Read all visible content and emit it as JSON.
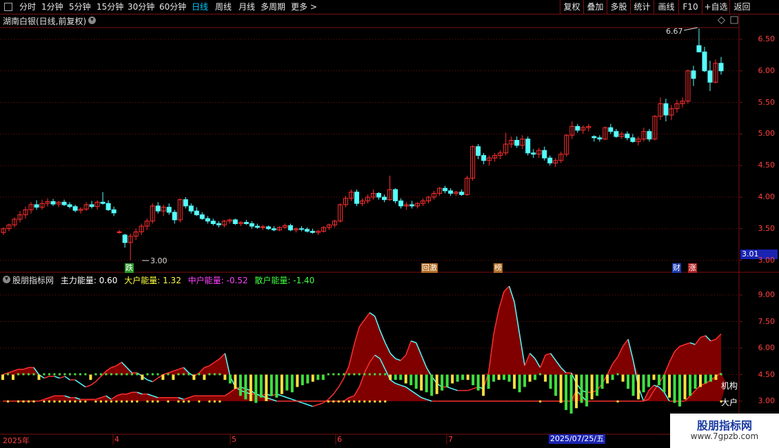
{
  "toolbar": {
    "periods": [
      {
        "label": "分时",
        "active": false
      },
      {
        "label": "1分钟",
        "active": false
      },
      {
        "label": "5分钟",
        "active": false
      },
      {
        "label": "15分钟",
        "active": false
      },
      {
        "label": "30分钟",
        "active": false
      },
      {
        "label": "60分钟",
        "active": false
      },
      {
        "label": "日线",
        "active": true
      },
      {
        "label": "周线",
        "active": false
      },
      {
        "label": "月线",
        "active": false
      },
      {
        "label": "多周期",
        "active": false
      },
      {
        "label": "更多 >",
        "active": false
      }
    ],
    "actions": [
      "复权",
      "叠加",
      "多股",
      "统计",
      "画线",
      "F10",
      "+自选",
      "返回"
    ]
  },
  "stock": {
    "title": "湖南白银(日线,前复权)",
    "dropdown_icon": "chevron-down-icon",
    "high_annotation": "6.67",
    "low_annotation": "3.00",
    "price_badge": "3.01",
    "tools_icons": [
      "diamond-icon",
      "chart-toggle-icon"
    ]
  },
  "price_axis": [
    "6.50",
    "6.00",
    "5.50",
    "5.00",
    "4.50",
    "4.00",
    "3.50",
    "3.00"
  ],
  "events": [
    {
      "label": "跌",
      "color": "#2a9a2a",
      "text_color": "#fff"
    },
    {
      "label": "回激",
      "color": "#b06a20",
      "text_color": "#fff"
    },
    {
      "label": "榜",
      "color": "#b06a20",
      "text_color": "#fff"
    },
    {
      "label": "财",
      "color": "#1a3ab0",
      "text_color": "#fff"
    },
    {
      "label": "涨",
      "color": "#b02020",
      "text_color": "#fff"
    }
  ],
  "indicator": {
    "name": "股朋指标网",
    "legend": [
      {
        "label": "主力能量: 0.60",
        "color": "#ffffff"
      },
      {
        "label": "大户能量: 1.32",
        "color": "#ffff40"
      },
      {
        "label": "中户能量: -0.52",
        "color": "#ff40ff"
      },
      {
        "label": "散户能量: -1.40",
        "color": "#40ff40"
      }
    ],
    "axis": [
      "9.00",
      "7.50",
      "6.00",
      "4.50",
      "3.00"
    ],
    "line_labels": [
      "机构",
      "大户"
    ]
  },
  "dates": {
    "labels": [
      "2025年",
      "4",
      "5",
      "6",
      "7"
    ],
    "cursor": "2025/07/25/五"
  },
  "watermark": {
    "title": "股朋指标网",
    "url": "www.7gpzb.com"
  },
  "colors": {
    "up": "#ff3030",
    "down": "#54ffff",
    "grid": "#7a1010",
    "area": "#800000"
  },
  "chart_data": {
    "type": "candlestick",
    "y_range": [
      3.0,
      6.75
    ],
    "candles": [
      [
        3.44,
        3.52,
        3.4,
        3.5
      ],
      [
        3.5,
        3.58,
        3.46,
        3.56
      ],
      [
        3.56,
        3.68,
        3.52,
        3.65
      ],
      [
        3.65,
        3.78,
        3.6,
        3.72
      ],
      [
        3.72,
        3.85,
        3.66,
        3.8
      ],
      [
        3.8,
        3.92,
        3.74,
        3.88
      ],
      [
        3.88,
        3.95,
        3.8,
        3.84
      ],
      [
        3.84,
        3.96,
        3.8,
        3.9
      ],
      [
        3.9,
        3.98,
        3.85,
        3.93
      ],
      [
        3.93,
        3.97,
        3.86,
        3.89
      ],
      [
        3.89,
        3.94,
        3.84,
        3.92
      ],
      [
        3.92,
        3.96,
        3.86,
        3.88
      ],
      [
        3.88,
        3.92,
        3.82,
        3.85
      ],
      [
        3.85,
        3.88,
        3.76,
        3.79
      ],
      [
        3.79,
        3.84,
        3.74,
        3.81
      ],
      [
        3.81,
        3.92,
        3.78,
        3.88
      ],
      [
        3.88,
        3.94,
        3.82,
        3.85
      ],
      [
        3.85,
        3.95,
        3.8,
        3.92
      ],
      [
        3.92,
        4.08,
        3.88,
        3.9
      ],
      [
        3.9,
        3.95,
        3.78,
        3.8
      ],
      [
        3.8,
        3.85,
        3.7,
        3.75
      ],
      [
        3.45,
        3.48,
        3.42,
        3.45
      ],
      [
        3.4,
        3.42,
        3.2,
        3.28
      ],
      [
        3.28,
        3.42,
        3.0,
        3.38
      ],
      [
        3.38,
        3.5,
        3.32,
        3.45
      ],
      [
        3.45,
        3.58,
        3.4,
        3.54
      ],
      [
        3.54,
        3.66,
        3.48,
        3.62
      ],
      [
        3.62,
        3.9,
        3.58,
        3.86
      ],
      [
        3.86,
        3.92,
        3.74,
        3.78
      ],
      [
        3.78,
        3.88,
        3.7,
        3.84
      ],
      [
        3.84,
        3.9,
        3.72,
        3.76
      ],
      [
        3.76,
        3.8,
        3.58,
        3.64
      ],
      [
        3.64,
        3.98,
        3.6,
        3.96
      ],
      [
        3.96,
        4.0,
        3.82,
        3.86
      ],
      [
        3.86,
        3.9,
        3.74,
        3.78
      ],
      [
        3.78,
        3.84,
        3.7,
        3.72
      ],
      [
        3.72,
        3.76,
        3.64,
        3.66
      ],
      [
        3.66,
        3.7,
        3.58,
        3.62
      ],
      [
        3.62,
        3.66,
        3.55,
        3.58
      ],
      [
        3.58,
        3.62,
        3.52,
        3.56
      ],
      [
        3.56,
        3.64,
        3.52,
        3.62
      ],
      [
        3.62,
        3.66,
        3.58,
        3.64
      ],
      [
        3.64,
        3.66,
        3.56,
        3.58
      ],
      [
        3.58,
        3.62,
        3.54,
        3.6
      ],
      [
        3.6,
        3.64,
        3.56,
        3.58
      ],
      [
        3.58,
        3.62,
        3.5,
        3.54
      ],
      [
        3.54,
        3.58,
        3.5,
        3.52
      ],
      [
        3.52,
        3.56,
        3.48,
        3.53
      ],
      [
        3.53,
        3.55,
        3.48,
        3.5
      ],
      [
        3.5,
        3.54,
        3.46,
        3.48
      ],
      [
        3.48,
        3.54,
        3.46,
        3.52
      ],
      [
        3.52,
        3.58,
        3.5,
        3.55
      ],
      [
        3.55,
        3.58,
        3.46,
        3.48
      ],
      [
        3.48,
        3.52,
        3.44,
        3.5
      ],
      [
        3.5,
        3.54,
        3.46,
        3.49
      ],
      [
        3.49,
        3.52,
        3.44,
        3.46
      ],
      [
        3.46,
        3.5,
        3.42,
        3.44
      ],
      [
        3.44,
        3.48,
        3.4,
        3.46
      ],
      [
        3.46,
        3.54,
        3.44,
        3.52
      ],
      [
        3.52,
        3.58,
        3.48,
        3.56
      ],
      [
        3.56,
        3.64,
        3.52,
        3.62
      ],
      [
        3.62,
        3.9,
        3.6,
        3.88
      ],
      [
        3.88,
        4.02,
        3.84,
        3.98
      ],
      [
        3.98,
        4.12,
        3.94,
        4.08
      ],
      [
        4.08,
        4.12,
        3.86,
        3.9
      ],
      [
        3.9,
        3.98,
        3.86,
        3.94
      ],
      [
        3.94,
        4.04,
        3.9,
        4.0
      ],
      [
        4.0,
        4.12,
        3.96,
        4.06
      ],
      [
        4.06,
        4.08,
        3.96,
        4.0
      ],
      [
        4.0,
        4.04,
        3.92,
        3.96
      ],
      [
        3.96,
        4.34,
        3.94,
        4.12
      ],
      [
        4.12,
        4.14,
        3.9,
        3.94
      ],
      [
        3.94,
        3.98,
        3.82,
        3.86
      ],
      [
        3.86,
        3.92,
        3.8,
        3.88
      ],
      [
        3.88,
        3.94,
        3.82,
        3.86
      ],
      [
        3.86,
        3.92,
        3.82,
        3.9
      ],
      [
        3.9,
        3.98,
        3.86,
        3.94
      ],
      [
        3.94,
        4.02,
        3.9,
        4.0
      ],
      [
        4.0,
        4.1,
        3.96,
        4.06
      ],
      [
        4.06,
        4.16,
        4.02,
        4.14
      ],
      [
        4.14,
        4.18,
        4.06,
        4.1
      ],
      [
        4.1,
        4.14,
        4.02,
        4.06
      ],
      [
        4.06,
        4.1,
        4.02,
        4.08
      ],
      [
        4.08,
        4.12,
        4.02,
        4.04
      ],
      [
        4.04,
        4.34,
        4.02,
        4.3
      ],
      [
        4.3,
        4.82,
        4.26,
        4.8
      ],
      [
        4.8,
        4.84,
        4.6,
        4.66
      ],
      [
        4.66,
        4.7,
        4.52,
        4.58
      ],
      [
        4.58,
        4.66,
        4.5,
        4.62
      ],
      [
        4.62,
        4.7,
        4.56,
        4.66
      ],
      [
        4.66,
        4.74,
        4.6,
        4.7
      ],
      [
        4.7,
        5.02,
        4.66,
        4.84
      ],
      [
        4.84,
        4.96,
        4.78,
        4.9
      ],
      [
        4.9,
        4.96,
        4.78,
        4.82
      ],
      [
        4.82,
        4.98,
        4.76,
        4.92
      ],
      [
        4.92,
        4.96,
        4.66,
        4.7
      ],
      [
        4.7,
        4.76,
        4.62,
        4.68
      ],
      [
        4.68,
        4.78,
        4.62,
        4.74
      ],
      [
        4.74,
        4.8,
        4.58,
        4.62
      ],
      [
        4.62,
        4.66,
        4.5,
        4.54
      ],
      [
        4.54,
        4.62,
        4.48,
        4.58
      ],
      [
        4.58,
        4.72,
        4.54,
        4.68
      ],
      [
        4.68,
        5.0,
        4.64,
        4.98
      ],
      [
        4.98,
        5.2,
        4.92,
        5.12
      ],
      [
        5.12,
        5.16,
        5.02,
        5.06
      ],
      [
        5.06,
        5.14,
        5.0,
        5.1
      ],
      [
        5.1,
        5.16,
        5.04,
        5.12
      ],
      [
        4.96,
        4.98,
        4.88,
        4.94
      ],
      [
        4.94,
        4.98,
        4.88,
        4.92
      ],
      [
        4.92,
        5.12,
        4.9,
        5.1
      ],
      [
        5.1,
        5.16,
        5.0,
        5.04
      ],
      [
        5.04,
        5.08,
        4.94,
        4.96
      ],
      [
        4.96,
        5.04,
        4.92,
        5.0
      ],
      [
        5.0,
        5.04,
        4.9,
        4.94
      ],
      [
        4.94,
        5.0,
        4.86,
        4.88
      ],
      [
        4.88,
        4.96,
        4.82,
        4.92
      ],
      [
        4.92,
        5.1,
        4.88,
        5.04
      ],
      [
        5.04,
        5.08,
        4.88,
        4.92
      ],
      [
        4.92,
        5.3,
        4.9,
        5.28
      ],
      [
        5.28,
        5.58,
        5.22,
        5.48
      ],
      [
        5.48,
        5.56,
        5.2,
        5.3
      ],
      [
        5.3,
        5.46,
        5.22,
        5.4
      ],
      [
        5.4,
        5.54,
        5.34,
        5.48
      ],
      [
        5.48,
        5.58,
        5.42,
        5.52
      ],
      [
        5.52,
        6.02,
        5.48,
        6.0
      ],
      [
        6.0,
        6.08,
        5.76,
        5.88
      ],
      [
        6.4,
        6.67,
        6.3,
        6.3
      ],
      [
        6.3,
        6.38,
        5.98,
        6.0
      ],
      [
        6.0,
        6.16,
        5.68,
        5.82
      ],
      [
        5.82,
        6.18,
        5.8,
        6.12
      ],
      [
        6.12,
        6.22,
        5.94,
        6.0
      ]
    ],
    "events": [
      "跌",
      "回激",
      "榜",
      "财",
      "涨"
    ],
    "indicator": {
      "axis_range": [
        1.5,
        9.75
      ],
      "jigou": [
        4.5,
        4.6,
        4.7,
        4.8,
        4.8,
        4.9,
        4.9,
        4.5,
        4.3,
        4.4,
        4.4,
        4.3,
        4.4,
        4.2,
        4.2,
        4.0,
        3.8,
        3.9,
        4.1,
        4.4,
        4.7,
        4.9,
        5.0,
        5.2,
        4.9,
        4.6,
        4.6,
        4.4,
        4.2,
        4.1,
        4.3,
        4.5,
        4.6,
        4.7,
        4.8,
        4.9,
        4.6,
        4.4,
        4.6,
        4.9,
        5.0,
        5.2,
        5.4,
        5.7,
        4.4,
        3.8,
        3.6,
        3.5,
        3.4,
        3.4,
        3.3,
        3.4,
        3.3,
        3.4,
        3.3,
        3.2,
        3.1,
        3.0,
        2.9,
        2.8,
        2.7,
        2.8,
        2.9,
        3.1,
        3.4,
        3.8,
        4.3,
        5.0,
        6.2,
        7.2,
        7.6,
        8.0,
        7.8,
        7.0,
        6.3,
        5.7,
        5.4,
        5.3,
        5.6,
        6.4,
        6.3,
        5.6,
        4.9,
        4.4,
        4.0,
        3.8,
        3.8,
        3.7,
        3.6,
        3.6,
        3.6,
        3.7,
        3.8,
        3.7,
        4.6,
        6.8,
        8.2,
        9.2,
        9.5,
        8.6,
        6.8,
        5.0,
        5.7,
        5.4,
        4.9,
        5.6,
        5.7,
        5.3,
        4.9,
        4.6,
        4.6,
        4.0,
        3.6,
        3.5,
        3.5,
        3.6,
        4.0,
        4.5,
        5.1,
        5.5,
        6.1,
        6.5,
        5.3,
        3.8,
        3.0,
        3.1,
        3.6,
        4.0,
        4.5,
        5.2,
        5.8,
        6.1,
        6.2,
        6.3,
        6.2,
        6.6,
        6.7,
        6.4,
        6.5,
        6.8
      ],
      "dahu": [
        3.0,
        3.0,
        3.0,
        3.0,
        3.0,
        3.0,
        3.0,
        3.0,
        3.1,
        3.2,
        3.3,
        3.3,
        3.3,
        3.2,
        3.2,
        3.1,
        3.1,
        3.1,
        3.1,
        3.2,
        3.3,
        3.1,
        3.3,
        3.4,
        3.4,
        3.5,
        3.5,
        3.4,
        3.4,
        3.3,
        3.2,
        3.2,
        3.2,
        3.2,
        3.2,
        3.1,
        3.2,
        3.3,
        3.3,
        3.3,
        3.3,
        3.3,
        3.3,
        3.3,
        3.5,
        3.7,
        3.8,
        3.7,
        3.6,
        3.4,
        3.3,
        3.2,
        3.1,
        3.0,
        3.0,
        3.0,
        3.0,
        3.0,
        3.0,
        3.0,
        3.0,
        3.0,
        3.0,
        3.0,
        3.0,
        3.0,
        3.0,
        3.2,
        3.3,
        3.8,
        4.6,
        5.2,
        5.6,
        5.4,
        4.8,
        4.2,
        4.0,
        3.9,
        3.8,
        3.6,
        3.4,
        3.2,
        3.1,
        3.0,
        3.0,
        3.0,
        3.0,
        3.0,
        3.0,
        3.0,
        3.0,
        3.0,
        3.0,
        3.0,
        3.0,
        3.0,
        3.0,
        3.0,
        3.0,
        3.0,
        3.0,
        3.0,
        3.0,
        3.0,
        3.0,
        3.0,
        3.0,
        3.0,
        3.0,
        3.0,
        3.0,
        3.6,
        3.3,
        3.0,
        3.0,
        3.0,
        3.0,
        3.0,
        3.0,
        3.0,
        3.0,
        3.0,
        3.0,
        3.0,
        3.0,
        3.6,
        3.9,
        3.8,
        3.5,
        3.0,
        3.0,
        3.0,
        3.0,
        3.3,
        3.6,
        3.9,
        4.0,
        4.2,
        4.4,
        4.6,
        4.0
      ],
      "sanhu_bars": [
        0.3,
        -0.2,
        0.3,
        -0.2,
        0.2,
        -0.1,
        0.2,
        0.3,
        -0.2,
        0.2,
        -0.2,
        0.2,
        -0.2,
        0.2,
        -0.1,
        0.2,
        -0.2,
        0.3,
        -0.2,
        0.2,
        -0.2,
        0.2,
        -0.1,
        0.2,
        -0.2,
        0.2,
        -0.2,
        0.3,
        -0.2,
        0.2,
        -0.2,
        0.3,
        -0.2,
        0.3,
        -0.2,
        0.2,
        -0.2,
        0.3,
        -0.2,
        0.3,
        -0.2,
        0.2,
        -0.2,
        0.3,
        -0.5,
        -0.8,
        -1.2,
        -1.4,
        -1.5,
        -1.6,
        -1.3,
        -1.5,
        -1.2,
        -1.3,
        -1.1,
        -0.9,
        -1.0,
        -0.7,
        -0.6,
        -0.5,
        -0.4,
        -0.3,
        -0.3,
        -0.2,
        -0.2,
        -0.2,
        -0.2,
        -0.2,
        -0.2,
        -0.2,
        -0.2,
        -0.2,
        -0.2,
        -0.2,
        -0.2,
        -0.3,
        -0.3,
        -0.3,
        -0.5,
        -0.6,
        -0.8,
        -0.9,
        -1.0,
        -1.2,
        -1.1,
        -0.9,
        -0.7,
        -0.5,
        -0.4,
        -0.3,
        -0.3,
        -0.6,
        -0.9,
        -1.2,
        -0.8,
        -0.4,
        -0.3,
        -0.3,
        -0.4,
        -0.8,
        -1.0,
        -0.7,
        -0.4,
        -0.3,
        -0.2,
        -0.4,
        -0.8,
        -1.2,
        -1.6,
        -2.0,
        -2.2,
        -1.9,
        -1.6,
        -1.8,
        -1.4,
        -1.2,
        -0.8,
        -0.5,
        -0.3,
        -0.2,
        -0.4,
        -0.8,
        -1.2,
        -1.4,
        -1.0,
        -0.7,
        -0.3,
        -0.6,
        -1.0,
        -1.3,
        -1.6,
        -1.8,
        -1.4,
        -1.2,
        -0.8,
        -0.7,
        -0.5,
        -0.4,
        -0.3,
        -0.2
      ]
    }
  }
}
